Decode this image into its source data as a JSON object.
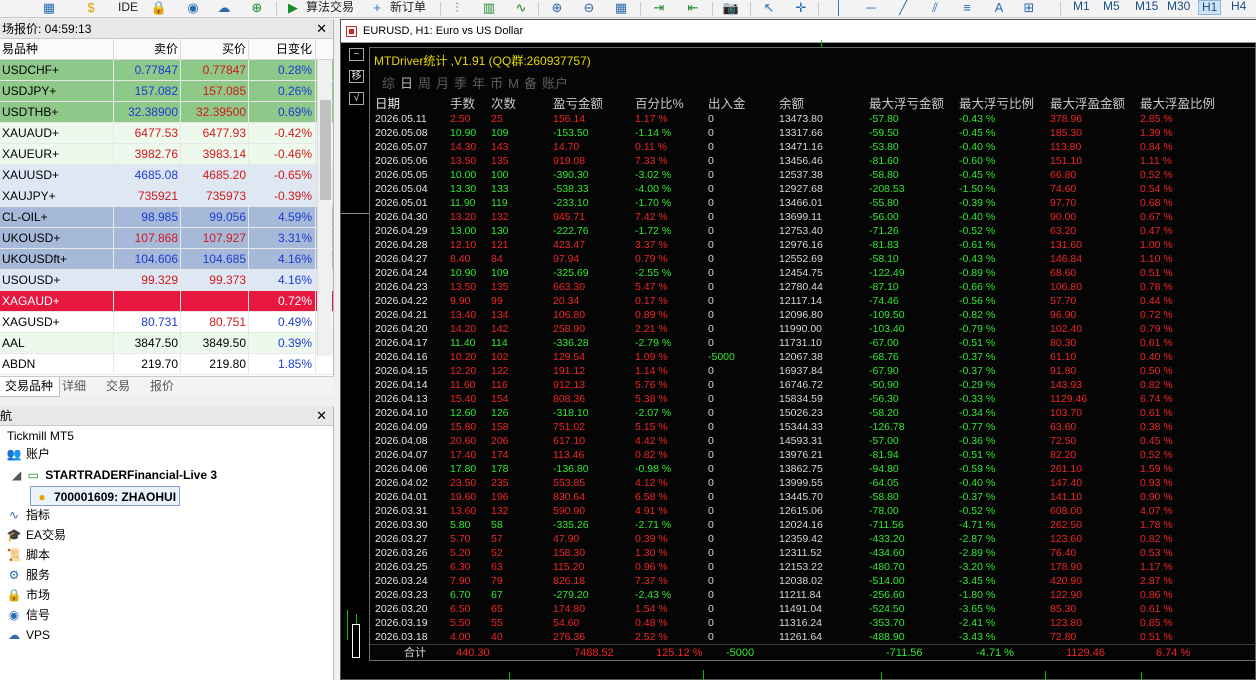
{
  "toolbar": {
    "ide": "IDE",
    "algo_trading": "算法交易",
    "new_order": "新订单",
    "timeframes": [
      "M1",
      "M5",
      "M15",
      "M30",
      "H1",
      "H4"
    ],
    "active_timeframe": "H1"
  },
  "market_watch": {
    "title": "场报价: 04:59:13",
    "headers": [
      "易品种",
      "卖价",
      "买价",
      "日变化"
    ],
    "rows": [
      {
        "symbol": "USDCHF+",
        "bid": "0.77847",
        "ask": "0.77847",
        "change": "0.28%",
        "style": "bg-green",
        "bid_dir": "up",
        "ask_dir": "dn",
        "chg_dir": "up"
      },
      {
        "symbol": "USDJPY+",
        "bid": "157.082",
        "ask": "157.085",
        "change": "0.26%",
        "style": "bg-green",
        "bid_dir": "up",
        "ask_dir": "dn",
        "chg_dir": "up"
      },
      {
        "symbol": "USDTHB+",
        "bid": "32.38900",
        "ask": "32.39500",
        "change": "0.69%",
        "style": "bg-green",
        "bid_dir": "up",
        "ask_dir": "dn",
        "chg_dir": "up"
      },
      {
        "symbol": "XAUAUD+",
        "bid": "6477.53",
        "ask": "6477.93",
        "change": "-0.42%",
        "style": "bg-lgreen",
        "bid_dir": "dn",
        "ask_dir": "dn",
        "chg_dir": "dn"
      },
      {
        "symbol": "XAUEUR+",
        "bid": "3982.76",
        "ask": "3983.14",
        "change": "-0.46%",
        "style": "bg-lgreen",
        "bid_dir": "dn",
        "ask_dir": "dn",
        "chg_dir": "dn"
      },
      {
        "symbol": "XAUUSD+",
        "bid": "4685.08",
        "ask": "4685.20",
        "change": "-0.65%",
        "style": "bg-lblue",
        "bid_dir": "up",
        "ask_dir": "dn",
        "chg_dir": "dn"
      },
      {
        "symbol": "XAUJPY+",
        "bid": "735921",
        "ask": "735973",
        "change": "-0.39%",
        "style": "bg-lblue",
        "bid_dir": "dn",
        "ask_dir": "dn",
        "chg_dir": "dn"
      },
      {
        "symbol": "CL-OIL+",
        "bid": "98.985",
        "ask": "99.056",
        "change": "4.59%",
        "style": "bg-blue",
        "bid_dir": "up",
        "ask_dir": "up",
        "chg_dir": "up"
      },
      {
        "symbol": "UKOUSD+",
        "bid": "107.868",
        "ask": "107.927",
        "change": "3.31%",
        "style": "bg-blue",
        "bid_dir": "dn",
        "ask_dir": "dn",
        "chg_dir": "up"
      },
      {
        "symbol": "UKOUSDft+",
        "bid": "104.606",
        "ask": "104.685",
        "change": "4.16%",
        "style": "bg-blue",
        "bid_dir": "up",
        "ask_dir": "up",
        "chg_dir": "up"
      },
      {
        "symbol": "USOUSD+",
        "bid": "99.329",
        "ask": "99.373",
        "change": "4.16%",
        "style": "bg-lblue",
        "bid_dir": "dn",
        "ask_dir": "dn",
        "chg_dir": "up"
      },
      {
        "symbol": "XAGAUD+",
        "bid": "",
        "ask": "",
        "change": "0.72%",
        "style": "bg-red",
        "bid_dir": "dn",
        "ask_dir": "dn",
        "chg_dir": "up"
      },
      {
        "symbol": "XAGUSD+",
        "bid": "80.731",
        "ask": "80.751",
        "change": "0.49%",
        "style": "bg-white",
        "bid_dir": "up",
        "ask_dir": "dn",
        "chg_dir": "up"
      },
      {
        "symbol": "AAL",
        "bid": "3847.50",
        "ask": "3849.50",
        "change": "0.39%",
        "style": "bg-lgreen",
        "bid_dir": "gw",
        "ask_dir": "gw",
        "chg_dir": "up"
      },
      {
        "symbol": "ABDN",
        "bid": "219.70",
        "ask": "219.80",
        "change": "1.85%",
        "style": "bg-white",
        "bid_dir": "gw",
        "ask_dir": "gw",
        "chg_dir": "up"
      }
    ],
    "tabs": [
      "交易品种",
      "详细",
      "交易",
      "报价"
    ]
  },
  "navigator": {
    "title": "航",
    "broker": "Tickmill MT5",
    "accounts_label": "账户",
    "server": "STARTRADERFinancial-Live 3",
    "account": "700001609: ZHAOHUI",
    "items": [
      "指标",
      "EA交易",
      "脚本",
      "服务",
      "市场",
      "信号",
      "VPS"
    ]
  },
  "chart": {
    "title": "EURUSD, H1:  Euro vs US Dollar",
    "panel_title": "MTDriver统计 ,V1.91 (QQ群:260937757)",
    "tabs": [
      "综",
      "日",
      "周",
      "月",
      "季",
      "年",
      "币",
      "M",
      "备",
      "账户"
    ],
    "active_tab": "日",
    "side_buttons": [
      "−",
      "移",
      "√"
    ],
    "headers": [
      "日期",
      "手数",
      "次数",
      "盈亏金额",
      "百分比%",
      "出入金",
      "余额",
      "最大浮亏金额",
      "最大浮亏比例",
      "最大浮盈金额",
      "最大浮盈比例"
    ],
    "rows": [
      [
        "2026.05.11",
        "2.50",
        "25",
        "156.14",
        "1.17 %",
        "0",
        "13473.80",
        "-57.80",
        "-0.43 %",
        "378.96",
        "2.85 %"
      ],
      [
        "2026.05.08",
        "10.90",
        "109",
        "-153.50",
        "-1.14 %",
        "0",
        "13317.66",
        "-59.50",
        "-0.45 %",
        "185.30",
        "1.39 %"
      ],
      [
        "2026.05.07",
        "14.30",
        "143",
        "14.70",
        "0.11 %",
        "0",
        "13471.16",
        "-53.80",
        "-0.40 %",
        "113.80",
        "0.84 %"
      ],
      [
        "2026.05.06",
        "13.50",
        "135",
        "919.08",
        "7.33 %",
        "0",
        "13456.46",
        "-81.60",
        "-0.60 %",
        "151.10",
        "1.11 %"
      ],
      [
        "2026.05.05",
        "10.00",
        "100",
        "-390.30",
        "-3.02 %",
        "0",
        "12537.38",
        "-58.80",
        "-0.45 %",
        "66.80",
        "0.52 %"
      ],
      [
        "2026.05.04",
        "13.30",
        "133",
        "-538.33",
        "-4.00 %",
        "0",
        "12927.68",
        "-208.53",
        "-1.50 %",
        "74.60",
        "0.54 %"
      ],
      [
        "2026.05.01",
        "11.90",
        "119",
        "-233.10",
        "-1.70 %",
        "0",
        "13466.01",
        "-55.80",
        "-0.39 %",
        "97.70",
        "0.68 %"
      ],
      [
        "2026.04.30",
        "13.20",
        "132",
        "945.71",
        "7.42 %",
        "0",
        "13699.11",
        "-56.00",
        "-0.40 %",
        "90.00",
        "0.67 %"
      ],
      [
        "2026.04.29",
        "13.00",
        "130",
        "-222.76",
        "-1.72 %",
        "0",
        "12753.40",
        "-71.26",
        "-0.52 %",
        "63.20",
        "0.47 %"
      ],
      [
        "2026.04.28",
        "12.10",
        "121",
        "423.47",
        "3.37 %",
        "0",
        "12976.16",
        "-81.83",
        "-0.61 %",
        "131.60",
        "1.00 %"
      ],
      [
        "2026.04.27",
        "8.40",
        "84",
        "97.94",
        "0.79 %",
        "0",
        "12552.69",
        "-58.10",
        "-0.43 %",
        "146.84",
        "1.10 %"
      ],
      [
        "2026.04.24",
        "10.90",
        "109",
        "-325.69",
        "-2.55 %",
        "0",
        "12454.75",
        "-122.49",
        "-0.89 %",
        "68.60",
        "0.51 %"
      ],
      [
        "2026.04.23",
        "13.50",
        "135",
        "663.30",
        "5.47 %",
        "0",
        "12780.44",
        "-87.10",
        "-0.66 %",
        "106.80",
        "0.78 %"
      ],
      [
        "2026.04.22",
        "9.90",
        "99",
        "20.34",
        "0.17 %",
        "0",
        "12117.14",
        "-74.46",
        "-0.56 %",
        "57.70",
        "0.44 %"
      ],
      [
        "2026.04.21",
        "13.40",
        "134",
        "106.80",
        "0.89 %",
        "0",
        "12096.80",
        "-109.50",
        "-0.82 %",
        "96.90",
        "0.72 %"
      ],
      [
        "2026.04.20",
        "14.20",
        "142",
        "258.90",
        "2.21 %",
        "0",
        "11990.00",
        "-103.40",
        "-0.79 %",
        "102.40",
        "0.79 %"
      ],
      [
        "2026.04.17",
        "11.40",
        "114",
        "-336.28",
        "-2.79 %",
        "0",
        "11731.10",
        "-67.00",
        "-0.51 %",
        "80.30",
        "0.61 %"
      ],
      [
        "2026.04.16",
        "10.20",
        "102",
        "129.54",
        "1.09 %",
        "-5000",
        "12067.38",
        "-68.76",
        "-0.37 %",
        "61.10",
        "0.40 %"
      ],
      [
        "2026.04.15",
        "12.20",
        "122",
        "191.12",
        "1.14 %",
        "0",
        "16937.84",
        "-67.90",
        "-0.37 %",
        "91.80",
        "0.50 %"
      ],
      [
        "2026.04.14",
        "11.60",
        "116",
        "912.13",
        "5.76 %",
        "0",
        "16746.72",
        "-50.90",
        "-0.29 %",
        "143.93",
        "0.82 %"
      ],
      [
        "2026.04.13",
        "15.40",
        "154",
        "808.36",
        "5.38 %",
        "0",
        "15834.59",
        "-56.30",
        "-0.33 %",
        "1129.46",
        "6.74 %"
      ],
      [
        "2026.04.10",
        "12.60",
        "126",
        "-318.10",
        "-2.07 %",
        "0",
        "15026.23",
        "-58.20",
        "-0.34 %",
        "103.70",
        "0.61 %"
      ],
      [
        "2026.04.09",
        "15.80",
        "158",
        "751.02",
        "5.15 %",
        "0",
        "15344.33",
        "-126.78",
        "-0.77 %",
        "63.60",
        "0.38 %"
      ],
      [
        "2026.04.08",
        "20.60",
        "206",
        "617.10",
        "4.42 %",
        "0",
        "14593.31",
        "-57.00",
        "-0.36 %",
        "72.50",
        "0.45 %"
      ],
      [
        "2026.04.07",
        "17.40",
        "174",
        "113.46",
        "0.82 %",
        "0",
        "13976.21",
        "-81.94",
        "-0.51 %",
        "82.20",
        "0.52 %"
      ],
      [
        "2026.04.06",
        "17.80",
        "178",
        "-136.80",
        "-0.98 %",
        "0",
        "13862.75",
        "-94.80",
        "-0.59 %",
        "261.10",
        "1.59 %"
      ],
      [
        "2026.04.02",
        "23.50",
        "235",
        "553.85",
        "4.12 %",
        "0",
        "13999.55",
        "-64.05",
        "-0.40 %",
        "147.40",
        "0.93 %"
      ],
      [
        "2026.04.01",
        "19.60",
        "196",
        "830.64",
        "6.58 %",
        "0",
        "13445.70",
        "-58.80",
        "-0.37 %",
        "141.10",
        "0.90 %"
      ],
      [
        "2026.03.31",
        "13.60",
        "132",
        "590.90",
        "4.91 %",
        "0",
        "12615.06",
        "-78.00",
        "-0.52 %",
        "608.00",
        "4.07 %"
      ],
      [
        "2026.03.30",
        "5.80",
        "58",
        "-335.26",
        "-2.71 %",
        "0",
        "12024.16",
        "-711.56",
        "-4.71 %",
        "262.50",
        "1.78 %"
      ],
      [
        "2026.03.27",
        "5.70",
        "57",
        "47.90",
        "0.39 %",
        "0",
        "12359.42",
        "-433.20",
        "-2.87 %",
        "123.60",
        "0.82 %"
      ],
      [
        "2026.03.26",
        "5.20",
        "52",
        "158.30",
        "1.30 %",
        "0",
        "12311.52",
        "-434.60",
        "-2.89 %",
        "76.40",
        "0.53 %"
      ],
      [
        "2026.03.25",
        "6.30",
        "63",
        "115.20",
        "0.96 %",
        "0",
        "12153.22",
        "-480.70",
        "-3.20 %",
        "178.90",
        "1.17 %"
      ],
      [
        "2026.03.24",
        "7.90",
        "79",
        "826.18",
        "7.37 %",
        "0",
        "12038.02",
        "-514.00",
        "-3.45 %",
        "420.90",
        "2.87 %"
      ],
      [
        "2026.03.23",
        "6.70",
        "67",
        "-279.20",
        "-2.43 %",
        "0",
        "11211.84",
        "-256.60",
        "-1.80 %",
        "122.90",
        "0.86 %"
      ],
      [
        "2026.03.20",
        "6.50",
        "65",
        "174.80",
        "1.54 %",
        "0",
        "11491.04",
        "-524.50",
        "-3.65 %",
        "85.30",
        "0.61 %"
      ],
      [
        "2026.03.19",
        "5.50",
        "55",
        "54.60",
        "0.48 %",
        "0",
        "11316.24",
        "-353.70",
        "-2.41 %",
        "123.80",
        "0.85 %"
      ],
      [
        "2026.03.18",
        "4.00",
        "40",
        "276.36",
        "2.52 %",
        "0",
        "11261.64",
        "-488.90",
        "-3.43 %",
        "72.80",
        "0.51 %"
      ]
    ],
    "total": {
      "label": "合计",
      "lots": "440.30",
      "profit": "7488.52",
      "percent": "125.12 %",
      "deposit": "-5000",
      "max_dd": "-711.56",
      "max_dd_pct": "-4.71 %",
      "max_profit": "1129.46",
      "max_profit_pct": "6.74 %"
    },
    "colors": {
      "profit": "#ef2626",
      "loss": "#33e633",
      "title": "#e8d900"
    }
  }
}
